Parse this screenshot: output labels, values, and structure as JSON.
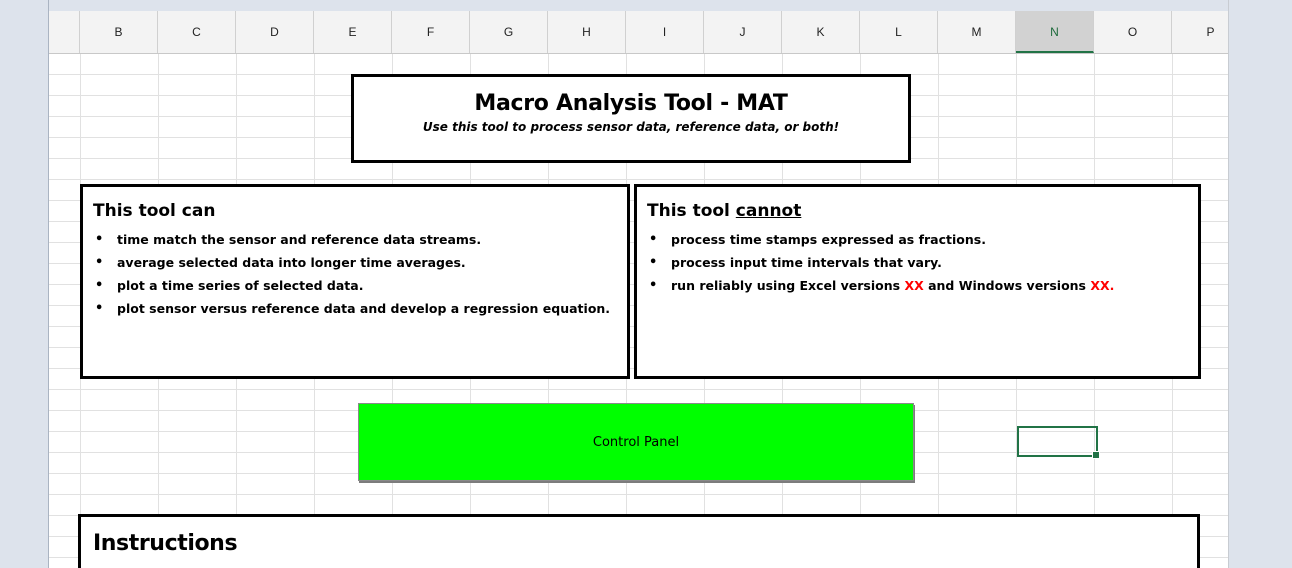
{
  "columns": [
    {
      "letter": "B",
      "selected": false
    },
    {
      "letter": "C",
      "selected": false
    },
    {
      "letter": "D",
      "selected": false
    },
    {
      "letter": "E",
      "selected": false
    },
    {
      "letter": "F",
      "selected": false
    },
    {
      "letter": "G",
      "selected": false
    },
    {
      "letter": "H",
      "selected": false
    },
    {
      "letter": "I",
      "selected": false
    },
    {
      "letter": "J",
      "selected": false
    },
    {
      "letter": "K",
      "selected": false
    },
    {
      "letter": "L",
      "selected": false
    },
    {
      "letter": "M",
      "selected": false
    },
    {
      "letter": "N",
      "selected": true
    },
    {
      "letter": "O",
      "selected": false
    },
    {
      "letter": "P",
      "selected": false
    }
  ],
  "title": {
    "heading": "Macro Analysis Tool - MAT",
    "subtitle": "Use this tool to process sensor data, reference data, or both!"
  },
  "can": {
    "heading": "This tool can",
    "items": [
      "time match the sensor and reference data streams.",
      "average selected data into longer time averages.",
      "plot a time series of selected data.",
      "plot sensor versus reference data and develop a regression equation."
    ]
  },
  "cannot": {
    "heading_prefix": "This tool ",
    "heading_emphasis": "cannot",
    "items": [
      "process time stamps expressed as fractions.",
      "process input time intervals that vary."
    ],
    "item3": {
      "part1": "run reliably using Excel versions ",
      "xx1": "XX",
      "part2": " and Windows versions ",
      "xx2": "XX."
    }
  },
  "control_button": {
    "label": "Control Panel"
  },
  "instructions": {
    "heading": "Instructions"
  },
  "colors": {
    "button_green": "#00ff00",
    "accent_red": "#ff0000",
    "selection_green": "#217346",
    "gridline": "#e1e1e1"
  }
}
